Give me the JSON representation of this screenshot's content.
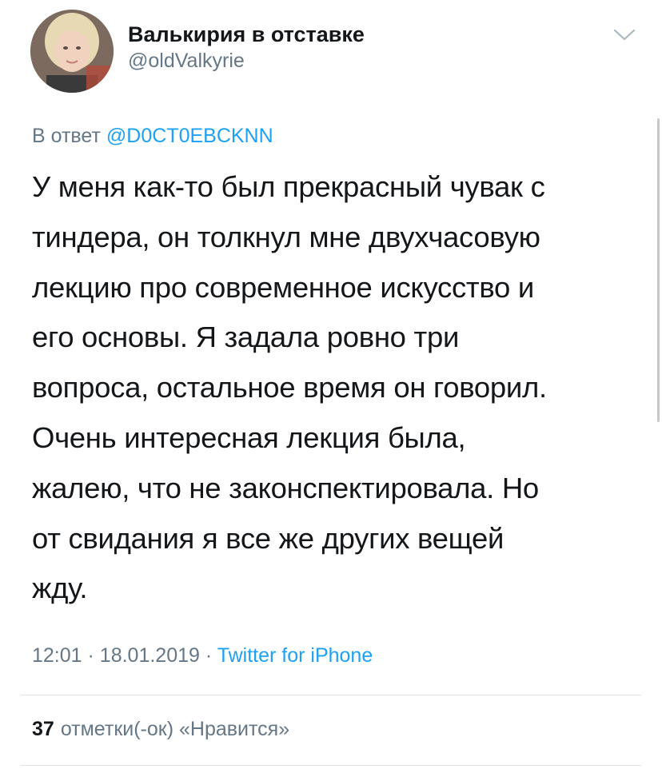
{
  "author": {
    "display_name": "Валькирия в отставке",
    "handle": "@oldValkyrie",
    "avatar_icon": "profile-photo"
  },
  "reply": {
    "prefix": "В ответ",
    "mention": "@D0CT0EBCKNN"
  },
  "tweet": {
    "lines": [
      "У меня как-то был прекрасный чувак с",
      "тиндера, он толкнул мне двухчасовую",
      "лекцию про современное искусство и",
      "его основы. Я задала ровно три",
      "вопроса, остальное время он говорил.",
      "Очень интересная лекция была,",
      "жалею, что не законспектировала. Но",
      "от свидания я все же других вещей",
      "жду."
    ]
  },
  "meta": {
    "time": "12:01",
    "date": "18.01.2019",
    "separator": "·",
    "source": "Twitter for iPhone"
  },
  "stats": {
    "likes_count": "37",
    "likes_label": "отметки(-ок) «Нравится»"
  },
  "colors": {
    "text": "#14171a",
    "secondary": "#657786",
    "link": "#1da1f2",
    "divider": "#dfe3e6"
  },
  "icons": {
    "more": "chevron-down-icon"
  }
}
